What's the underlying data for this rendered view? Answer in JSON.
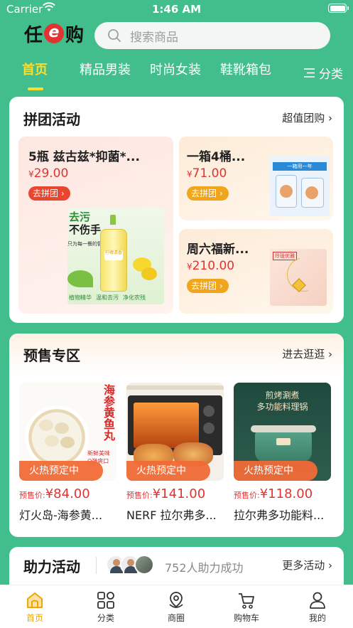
{
  "status_bar": {
    "carrier": "Carrier",
    "time": "1:46 AM"
  },
  "header": {
    "logo_left": "任",
    "logo_e": "e",
    "logo_right": "购",
    "search_placeholder": "搜索商品"
  },
  "tabs": [
    {
      "label": "首页",
      "active": true
    },
    {
      "label": "精品男装",
      "active": false
    },
    {
      "label": "时尚女装",
      "active": false
    },
    {
      "label": "鞋靴箱包",
      "active": false
    }
  ],
  "category_button": "分类",
  "group_buy": {
    "title": "拼团活动",
    "link": "超值团购",
    "items": [
      {
        "name": "5瓶 兹古兹*抑菌*...",
        "currency": "¥",
        "price": "29.00",
        "button": "去拼团",
        "image_text": [
          "去污",
          "不伤手",
          "只为每一餐的健康",
          "柠檬清香",
          "植物精华",
          "温和去污",
          "净化农残"
        ]
      },
      {
        "name": "一箱4桶...",
        "currency": "¥",
        "price": "71.00",
        "button": "去拼团",
        "image_text": [
          "一箱用一年"
        ]
      },
      {
        "name": "周六福新...",
        "currency": "¥",
        "price": "210.00",
        "button": "去拼团",
        "image_text": [
          "玲珑优雅"
        ]
      }
    ]
  },
  "presale": {
    "title": "预售专区",
    "link": "进去逛逛",
    "tag": "火热预定中",
    "price_prefix": "预售价:",
    "items": [
      {
        "name": "灯火岛-海参黄...",
        "currency": "¥",
        "price": "84.00",
        "image_text": [
          "海参黄鱼丸",
          "新鲜美味",
          "Q弹爽口"
        ]
      },
      {
        "name": "NERF 拉尔弗多...",
        "currency": "¥",
        "price": "141.00",
        "image_text": []
      },
      {
        "name": "拉尔弗多功能料...",
        "currency": "¥",
        "price": "118.00",
        "image_text": [
          "煎烤涮煮",
          "多功能料理锅"
        ]
      }
    ]
  },
  "assist": {
    "title": "助力活动",
    "count_text": "752人助力成功",
    "link": "更多活动"
  },
  "tabbar": [
    {
      "label": "首页",
      "icon": "home-icon",
      "active": true
    },
    {
      "label": "分类",
      "icon": "grid-icon",
      "active": false
    },
    {
      "label": "商圈",
      "icon": "location-pin-icon",
      "active": false
    },
    {
      "label": "购物车",
      "icon": "cart-icon",
      "active": false
    },
    {
      "label": "我的",
      "icon": "user-icon",
      "active": false
    }
  ],
  "colors": {
    "brand_green": "#42be8c",
    "accent_yellow": "#ffdc28",
    "price_red": "#e23333",
    "active_tab_orange": "#f0a700"
  }
}
